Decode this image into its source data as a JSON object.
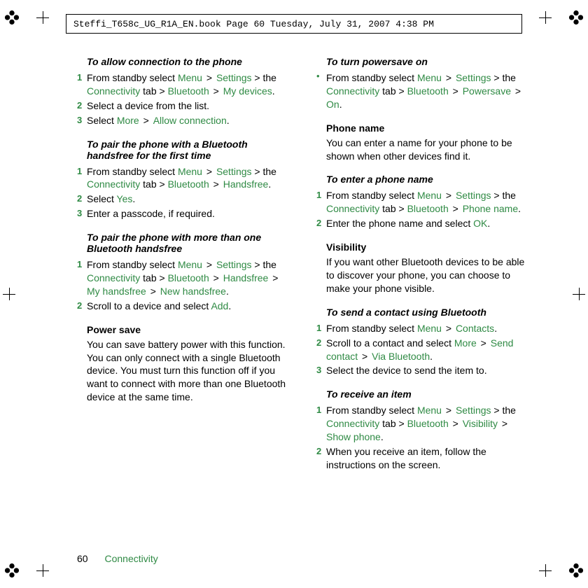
{
  "header_line": "Steffi_T658c_UG_R1A_EN.book  Page 60  Tuesday, July 31, 2007  4:38 PM",
  "footer": {
    "page": "60",
    "section": "Connectivity"
  },
  "allow_conn": {
    "heading": "To allow connection to the phone",
    "s1": {
      "num": "1",
      "t0": "From standby select ",
      "m0": "Menu",
      "gt0": " > ",
      "m1": "Settings",
      "gt1": " > the ",
      "m2": "Connectivity",
      "t1": " tab > ",
      "m3": "Bluetooth",
      "gt2": " > ",
      "m4": "My devices",
      "dot": "."
    },
    "s2": {
      "num": "2",
      "text": "Select a device from the list."
    },
    "s3": {
      "num": "3",
      "t0": "Select ",
      "m0": "More",
      "gt0": " > ",
      "m1": "Allow connection",
      "dot": "."
    }
  },
  "pair_first": {
    "heading": "To pair the phone with a Bluetooth handsfree for the first time",
    "s1": {
      "num": "1",
      "t0": "From standby select ",
      "m0": "Menu",
      "gt0": " > ",
      "m1": "Settings",
      "gt1": " > the ",
      "m2": "Connectivity",
      "t1": " tab > ",
      "m3": "Bluetooth",
      "gt2": " > ",
      "m4": "Handsfree",
      "dot": "."
    },
    "s2": {
      "num": "2",
      "t0": "Select ",
      "m0": "Yes",
      "dot": "."
    },
    "s3": {
      "num": "3",
      "text": "Enter a passcode, if required."
    }
  },
  "pair_more": {
    "heading": "To pair the phone with more than one Bluetooth handsfree",
    "s1": {
      "num": "1",
      "t0": "From standby select ",
      "m0": "Menu",
      "gt0": " > ",
      "m1": "Settings",
      "gt1": " > the ",
      "m2": "Connectivity",
      "t1": " tab > ",
      "m3": "Bluetooth",
      "gt2": " > ",
      "m4": "Handsfree",
      "gt3": " > ",
      "m5": "My handsfree",
      "gt4": " > ",
      "m6": "New handsfree",
      "dot": "."
    },
    "s2": {
      "num": "2",
      "t0": "Scroll to a device and select ",
      "m0": "Add",
      "dot": "."
    }
  },
  "powersave": {
    "title": "Power save",
    "para": "You can save battery power with this function. You can only connect with a single Bluetooth device. You must turn this function off if you want to connect with more than one Bluetooth device at the same time."
  },
  "powersave_on": {
    "heading": "To turn powersave on",
    "s1": {
      "bullet": "•",
      "t0": "From standby select ",
      "m0": "Menu",
      "gt0": " > ",
      "m1": "Settings",
      "gt1": " > the ",
      "m2": "Connectivity",
      "t1": " tab > ",
      "m3": "Bluetooth",
      "gt2": " > ",
      "m4": "Powersave",
      "gt3": " > ",
      "m5": "On",
      "dot": "."
    }
  },
  "phone_name": {
    "title": "Phone name",
    "para": "You can enter a name for your phone to be shown when other devices find it."
  },
  "enter_name": {
    "heading": "To enter a phone name",
    "s1": {
      "num": "1",
      "t0": "From standby select ",
      "m0": "Menu",
      "gt0": " > ",
      "m1": "Settings",
      "gt1": " > the ",
      "m2": "Connectivity",
      "t1": " tab > ",
      "m3": "Bluetooth",
      "gt2": " > ",
      "m4": "Phone name",
      "dot": "."
    },
    "s2": {
      "num": "2",
      "t0": "Enter the phone name and select ",
      "m0": "OK",
      "dot": "."
    }
  },
  "visibility": {
    "title": "Visibility",
    "para": "If you want other Bluetooth devices to be able to discover your phone, you can choose to make your phone visible."
  },
  "send_contact": {
    "heading": "To send a contact using Bluetooth",
    "s1": {
      "num": "1",
      "t0": "From standby select ",
      "m0": "Menu",
      "gt0": " > ",
      "m1": "Contacts",
      "dot": "."
    },
    "s2": {
      "num": "2",
      "t0": "Scroll to a contact and select ",
      "m0": "More",
      "gt0": " > ",
      "m1": "Send contact",
      "gt1": " > ",
      "m2": "Via Bluetooth",
      "dot": "."
    },
    "s3": {
      "num": "3",
      "text": "Select the device to send the item to."
    }
  },
  "receive_item": {
    "heading": "To receive an item",
    "s1": {
      "num": "1",
      "t0": "From standby select ",
      "m0": "Menu",
      "gt0": " > ",
      "m1": "Settings",
      "gt1": " > the ",
      "m2": "Connectivity",
      "t1": " tab > ",
      "m3": "Bluetooth",
      "gt2": " > ",
      "m4": "Visibility",
      "gt3": " > ",
      "m5": "Show phone",
      "dot": "."
    },
    "s2": {
      "num": "2",
      "text": "When you receive an item, follow the instructions on the screen."
    }
  }
}
